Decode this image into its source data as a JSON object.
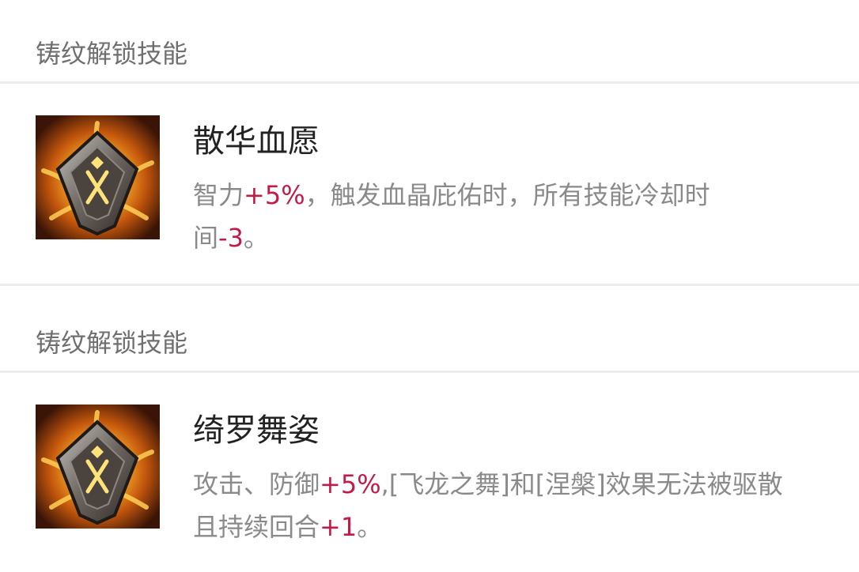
{
  "colors": {
    "highlight": "#c21b48",
    "text_gray": "#8a8a8a",
    "title": "#222222",
    "divider": "#ececec"
  },
  "sections": [
    {
      "header": "铸纹解锁技能",
      "icon": "shield-rune-icon",
      "title": "散华血愿",
      "desc": {
        "p1": "智力",
        "v1": "+5%",
        "p2": "，触发血晶庇佑时，所有技能冷却时",
        "p3": "间",
        "v2": "-3",
        "p4": "。"
      }
    },
    {
      "header": "铸纹解锁技能",
      "icon": "shield-rune-icon",
      "title": "绮罗舞姿",
      "desc": {
        "p1": "攻击、防御",
        "v1": "+5%",
        "p2": ",[飞龙之舞]和[涅槃]效果无法被驱散",
        "p3": "且持续回合",
        "v2": "+1",
        "p4": "。"
      }
    }
  ]
}
